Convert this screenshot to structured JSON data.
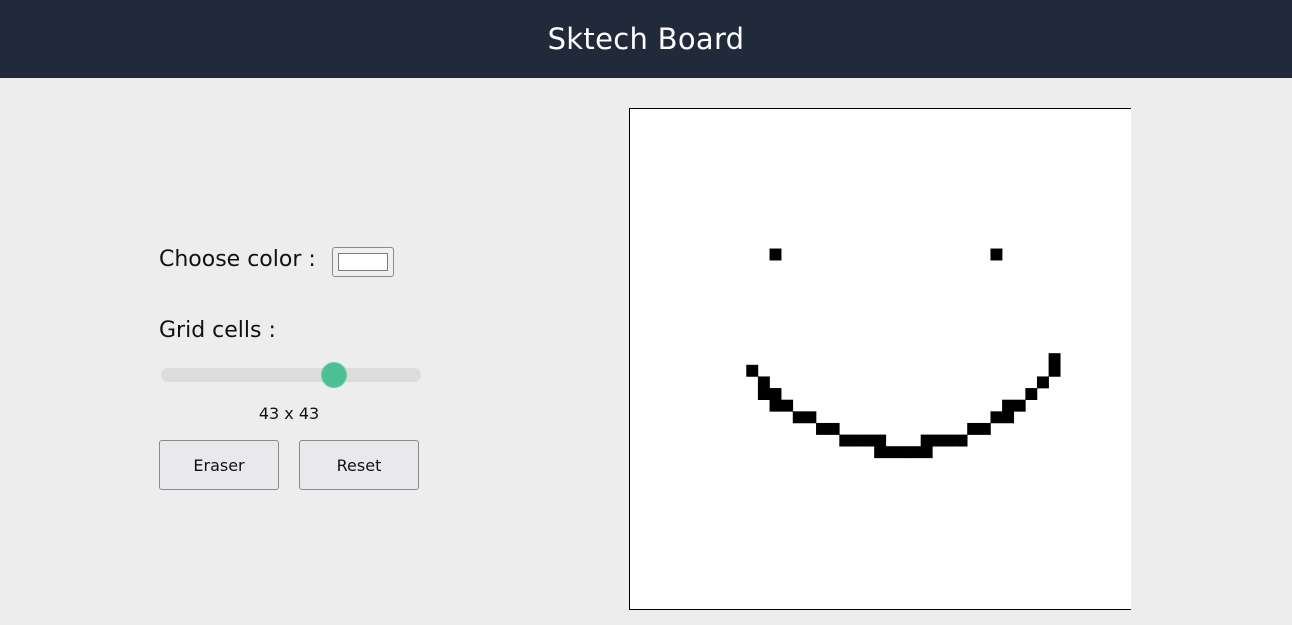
{
  "header": {
    "title": "Sktech Board"
  },
  "controls": {
    "color_label": "Choose color :",
    "color_value": "#ffffff",
    "grid_label": "Grid cells :",
    "grid_size": 43,
    "grid_min": 1,
    "grid_max": 64,
    "grid_readout": "43 x 43",
    "eraser_label": "Eraser",
    "reset_label": "Reset"
  },
  "colors": {
    "header_bg": "#212a3a",
    "page_bg": "#ededed",
    "slider_thumb": "#4cbf94",
    "ink": "#000000"
  },
  "board": {
    "cells": 43,
    "filled": [
      [
        12,
        12
      ],
      [
        31,
        12
      ],
      [
        36,
        21
      ],
      [
        36,
        22
      ],
      [
        10,
        22
      ],
      [
        11,
        23
      ],
      [
        35,
        23
      ],
      [
        11,
        24
      ],
      [
        12,
        24
      ],
      [
        34,
        24
      ],
      [
        12,
        25
      ],
      [
        13,
        25
      ],
      [
        32,
        25
      ],
      [
        33,
        25
      ],
      [
        14,
        26
      ],
      [
        15,
        26
      ],
      [
        31,
        26
      ],
      [
        32,
        26
      ],
      [
        16,
        27
      ],
      [
        17,
        27
      ],
      [
        29,
        27
      ],
      [
        30,
        27
      ],
      [
        18,
        28
      ],
      [
        19,
        28
      ],
      [
        20,
        28
      ],
      [
        21,
        28
      ],
      [
        25,
        28
      ],
      [
        26,
        28
      ],
      [
        27,
        28
      ],
      [
        28,
        28
      ],
      [
        21,
        29
      ],
      [
        22,
        29
      ],
      [
        23,
        29
      ],
      [
        24,
        29
      ],
      [
        25,
        29
      ]
    ]
  }
}
